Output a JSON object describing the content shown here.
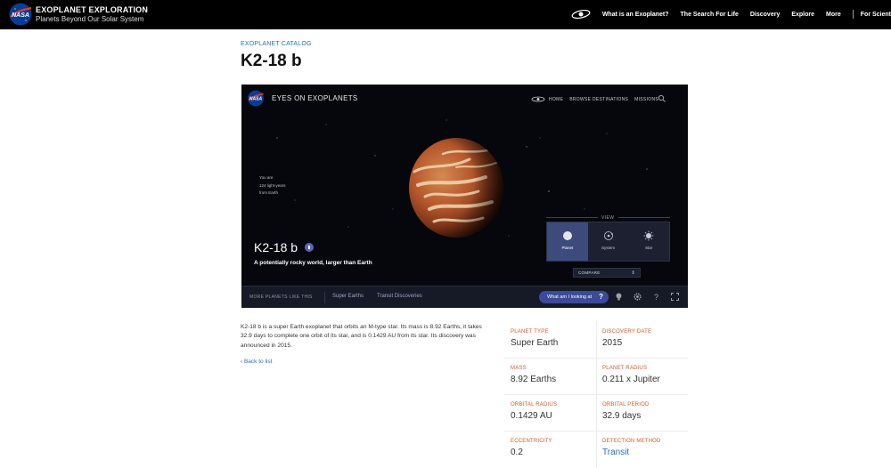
{
  "brand": {
    "title": "EXOPLANET EXPLORATION",
    "subtitle": "Planets Beyond Our Solar System"
  },
  "nav": {
    "items": [
      "What is an Exoplanet?",
      "The Search For Life",
      "Discovery",
      "Explore",
      "More"
    ],
    "cut_item": "For Scient"
  },
  "page": {
    "eyebrow": "EXOPLANET CATALOG",
    "title": "K2-18 b"
  },
  "viewer": {
    "title": "EYES ON EXOPLANETS",
    "nav": [
      "HOME",
      "BROWSE DESTINATIONS",
      "MISSIONS"
    ],
    "distance": [
      "You are",
      "124 light-years",
      "from Earth"
    ],
    "planet_name": "K2-18 b",
    "tagline": "A potentially rocky world, larger than Earth",
    "view_label": "VIEW",
    "view_buttons": [
      "Planet",
      "System",
      "Star"
    ],
    "compare": "COMPARE",
    "more_planets": "MORE PLANETS LIKE THIS",
    "links": [
      "Super Earths",
      "Transit Discoveries"
    ],
    "looking_label": "What am I looking at",
    "looking_q": "?",
    "colors": {
      "accent": "#3b4a9a",
      "active_view": "#3d4a7c"
    }
  },
  "description": "K2-18 b is a super Earth exoplanet that orbits an M-type star. Its mass is 8.92 Earths, it takes 32.9 days to complete one orbit of its star, and is 0.1429 AU from its star. Its discovery was announced in 2015.",
  "back_link": "‹ Back to list",
  "facts": [
    {
      "label": "PLANET TYPE",
      "value": "Super Earth"
    },
    {
      "label": "DISCOVERY DATE",
      "value": "2015"
    },
    {
      "label": "MASS",
      "value": "8.92 Earths"
    },
    {
      "label": "PLANET RADIUS",
      "value": "0.211 x Jupiter"
    },
    {
      "label": "ORBITAL RADIUS",
      "value": "0.1429 AU"
    },
    {
      "label": "ORBITAL PERIOD",
      "value": "32.9 days"
    },
    {
      "label": "ECCENTRICITY",
      "value": "0.2"
    },
    {
      "label": "DETECTION METHOD",
      "value": "Transit"
    }
  ],
  "colors": {
    "fact_label": "#d35a2a",
    "link": "#2a6fb8",
    "header_bg": "#000000"
  }
}
